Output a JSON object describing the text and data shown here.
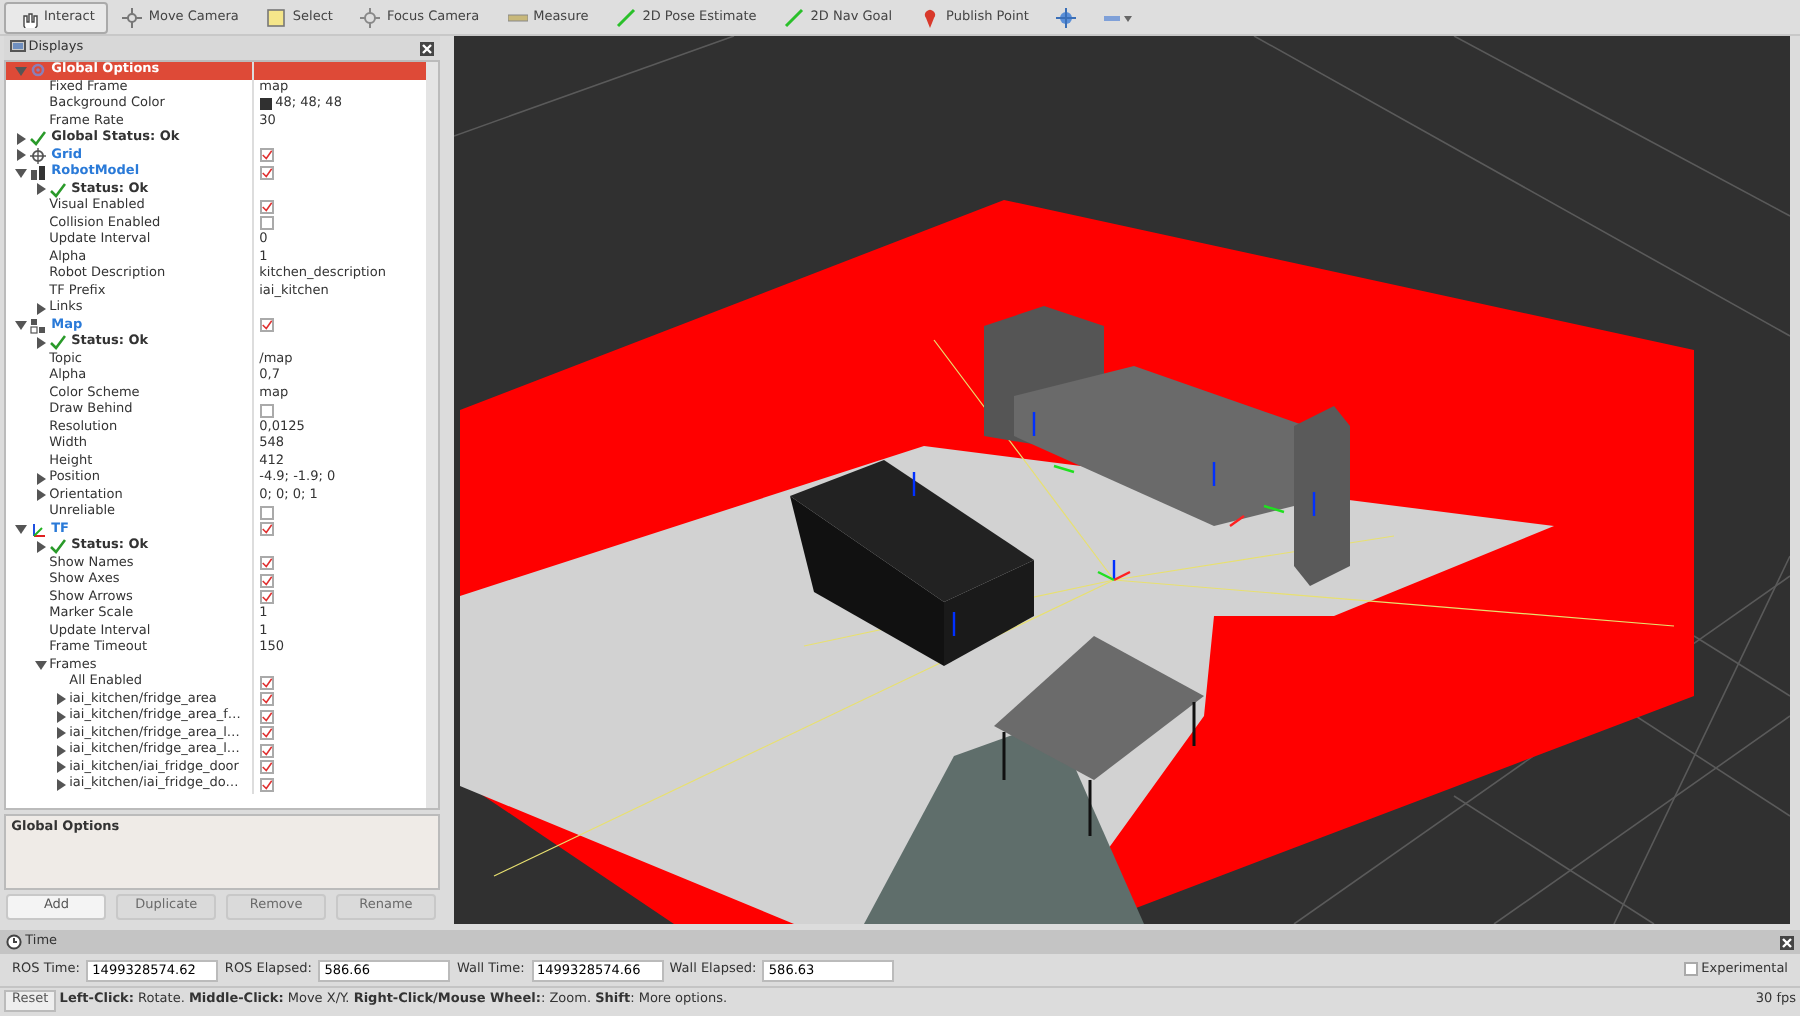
{
  "toolbar": {
    "tools": [
      {
        "kind": "interact",
        "label": "Interact",
        "selected": true
      },
      {
        "kind": "move",
        "label": "Move Camera",
        "selected": false
      },
      {
        "kind": "select",
        "label": "Select",
        "selected": false
      },
      {
        "kind": "focus",
        "label": "Focus Camera",
        "selected": false
      },
      {
        "kind": "measure",
        "label": "Measure",
        "selected": false
      },
      {
        "kind": "pose",
        "label": "2D Pose Estimate",
        "selected": false
      },
      {
        "kind": "goal",
        "label": "2D Nav Goal",
        "selected": false
      },
      {
        "kind": "point",
        "label": "Publish Point",
        "selected": false
      }
    ]
  },
  "displays": {
    "title": "Displays",
    "items": [
      {
        "kind": "options",
        "label": "Global Options",
        "selected": true,
        "expanded": true,
        "children": [
          {
            "kind": "property",
            "label": "Fixed Frame",
            "value": "map"
          },
          {
            "kind": "property",
            "label": "Background Color",
            "value": "48; 48; 48",
            "color": "#303030"
          },
          {
            "kind": "property",
            "label": "Frame Rate",
            "value": "30"
          }
        ]
      },
      {
        "kind": "status",
        "label": "Global Status: Ok",
        "selected": false,
        "expanded": false
      },
      {
        "kind": "grid",
        "label": "Grid",
        "selected": false,
        "expanded": false,
        "checked": true
      },
      {
        "kind": "robotmodel",
        "label": "RobotModel",
        "selected": false,
        "expanded": true,
        "checked": true,
        "children": [
          {
            "kind": "status",
            "label": "Status: Ok",
            "expanded": false
          },
          {
            "kind": "property",
            "label": "Visual Enabled",
            "checked": true
          },
          {
            "kind": "property",
            "label": "Collision Enabled",
            "checked": false
          },
          {
            "kind": "property",
            "label": "Update Interval",
            "value": "0"
          },
          {
            "kind": "property",
            "label": "Alpha",
            "value": "1"
          },
          {
            "kind": "property",
            "label": "Robot Description",
            "value": "kitchen_description"
          },
          {
            "kind": "property",
            "label": "TF Prefix",
            "value": "iai_kitchen"
          },
          {
            "kind": "property",
            "label": "Links",
            "expanded": false
          }
        ]
      },
      {
        "kind": "map",
        "label": "Map",
        "selected": false,
        "expanded": true,
        "checked": true,
        "children": [
          {
            "kind": "status",
            "label": "Status: Ok",
            "expanded": false
          },
          {
            "kind": "property",
            "label": "Topic",
            "value": "/map"
          },
          {
            "kind": "property",
            "label": "Alpha",
            "value": "0,7"
          },
          {
            "kind": "property",
            "label": "Color Scheme",
            "value": "map"
          },
          {
            "kind": "property",
            "label": "Draw Behind",
            "checked": false
          },
          {
            "kind": "property",
            "label": "Resolution",
            "value": "0,0125"
          },
          {
            "kind": "property",
            "label": "Width",
            "value": "548"
          },
          {
            "kind": "property",
            "label": "Height",
            "value": "412"
          },
          {
            "kind": "property",
            "label": "Position",
            "value": "-4.9; -1.9; 0",
            "expanded": false
          },
          {
            "kind": "property",
            "label": "Orientation",
            "value": "0; 0; 0; 1",
            "expanded": false
          },
          {
            "kind": "property",
            "label": "Unreliable",
            "checked": false
          }
        ]
      },
      {
        "kind": "tf",
        "label": "TF",
        "selected": false,
        "expanded": true,
        "checked": true,
        "children": [
          {
            "kind": "status",
            "label": "Status: Ok",
            "expanded": false
          },
          {
            "kind": "property",
            "label": "Show Names",
            "checked": true
          },
          {
            "kind": "property",
            "label": "Show Axes",
            "checked": true
          },
          {
            "kind": "property",
            "label": "Show Arrows",
            "checked": true
          },
          {
            "kind": "property",
            "label": "Marker Scale",
            "value": "1"
          },
          {
            "kind": "property",
            "label": "Update Interval",
            "value": "1"
          },
          {
            "kind": "property",
            "label": "Frame Timeout",
            "value": "150"
          },
          {
            "kind": "property",
            "label": "Frames",
            "expanded": true,
            "children": [
              {
                "kind": "property",
                "label": "All Enabled",
                "checked": true
              },
              {
                "kind": "property",
                "label": "iai_kitchen/fridge_area",
                "expanded": false,
                "checked": true
              },
              {
                "kind": "property",
                "label": "iai_kitchen/fridge_area_f…",
                "expanded": false,
                "checked": true
              },
              {
                "kind": "property",
                "label": "iai_kitchen/fridge_area_l…",
                "expanded": false,
                "checked": true
              },
              {
                "kind": "property",
                "label": "iai_kitchen/fridge_area_l…",
                "expanded": false,
                "checked": true
              },
              {
                "kind": "property",
                "label": "iai_kitchen/iai_fridge_door",
                "expanded": false,
                "checked": true
              },
              {
                "kind": "property",
                "label": "iai_kitchen/iai_fridge_do…",
                "expanded": false,
                "checked": true
              }
            ]
          }
        ]
      }
    ]
  },
  "description": {
    "title": "Global Options"
  },
  "buttons": [
    {
      "label": "Add",
      "disabled": false
    },
    {
      "label": "Duplicate",
      "disabled": true
    },
    {
      "label": "Remove",
      "disabled": true
    },
    {
      "label": "Rename",
      "disabled": true
    }
  ],
  "time": {
    "title": "Time",
    "fields": [
      {
        "label": "ROS Time:",
        "value": "1499328574.62"
      },
      {
        "label": "ROS Elapsed:",
        "value": "586.66"
      },
      {
        "label": "Wall Time:",
        "value": "1499328574.66"
      },
      {
        "label": "Wall Elapsed:",
        "value": "586.63"
      }
    ],
    "experimental": {
      "label": "Experimental",
      "checked": false
    }
  },
  "status_bar": {
    "reset": "Reset",
    "hint": "**Left-Click:** Rotate. **Middle-Click:** Move X/Y. **Right-Click/Mouse Wheel:**: Zoom. **Shift**: More options.",
    "fps": "30 fps"
  }
}
